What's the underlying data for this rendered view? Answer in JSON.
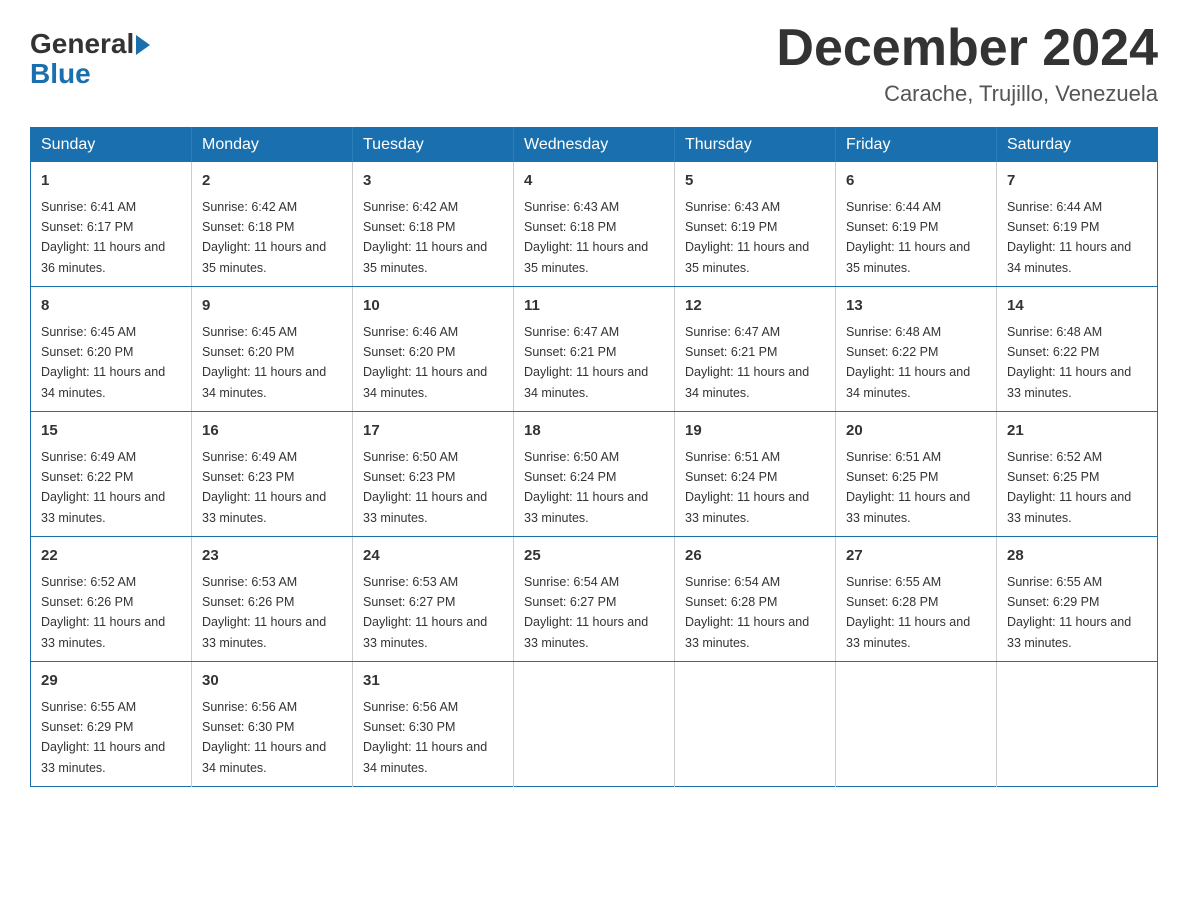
{
  "logo": {
    "general": "General",
    "blue": "Blue"
  },
  "title": {
    "month": "December 2024",
    "location": "Carache, Trujillo, Venezuela"
  },
  "headers": [
    "Sunday",
    "Monday",
    "Tuesday",
    "Wednesday",
    "Thursday",
    "Friday",
    "Saturday"
  ],
  "weeks": [
    [
      {
        "day": "1",
        "sunrise": "6:41 AM",
        "sunset": "6:17 PM",
        "daylight": "11 hours and 36 minutes."
      },
      {
        "day": "2",
        "sunrise": "6:42 AM",
        "sunset": "6:18 PM",
        "daylight": "11 hours and 35 minutes."
      },
      {
        "day": "3",
        "sunrise": "6:42 AM",
        "sunset": "6:18 PM",
        "daylight": "11 hours and 35 minutes."
      },
      {
        "day": "4",
        "sunrise": "6:43 AM",
        "sunset": "6:18 PM",
        "daylight": "11 hours and 35 minutes."
      },
      {
        "day": "5",
        "sunrise": "6:43 AM",
        "sunset": "6:19 PM",
        "daylight": "11 hours and 35 minutes."
      },
      {
        "day": "6",
        "sunrise": "6:44 AM",
        "sunset": "6:19 PM",
        "daylight": "11 hours and 35 minutes."
      },
      {
        "day": "7",
        "sunrise": "6:44 AM",
        "sunset": "6:19 PM",
        "daylight": "11 hours and 34 minutes."
      }
    ],
    [
      {
        "day": "8",
        "sunrise": "6:45 AM",
        "sunset": "6:20 PM",
        "daylight": "11 hours and 34 minutes."
      },
      {
        "day": "9",
        "sunrise": "6:45 AM",
        "sunset": "6:20 PM",
        "daylight": "11 hours and 34 minutes."
      },
      {
        "day": "10",
        "sunrise": "6:46 AM",
        "sunset": "6:20 PM",
        "daylight": "11 hours and 34 minutes."
      },
      {
        "day": "11",
        "sunrise": "6:47 AM",
        "sunset": "6:21 PM",
        "daylight": "11 hours and 34 minutes."
      },
      {
        "day": "12",
        "sunrise": "6:47 AM",
        "sunset": "6:21 PM",
        "daylight": "11 hours and 34 minutes."
      },
      {
        "day": "13",
        "sunrise": "6:48 AM",
        "sunset": "6:22 PM",
        "daylight": "11 hours and 34 minutes."
      },
      {
        "day": "14",
        "sunrise": "6:48 AM",
        "sunset": "6:22 PM",
        "daylight": "11 hours and 33 minutes."
      }
    ],
    [
      {
        "day": "15",
        "sunrise": "6:49 AM",
        "sunset": "6:22 PM",
        "daylight": "11 hours and 33 minutes."
      },
      {
        "day": "16",
        "sunrise": "6:49 AM",
        "sunset": "6:23 PM",
        "daylight": "11 hours and 33 minutes."
      },
      {
        "day": "17",
        "sunrise": "6:50 AM",
        "sunset": "6:23 PM",
        "daylight": "11 hours and 33 minutes."
      },
      {
        "day": "18",
        "sunrise": "6:50 AM",
        "sunset": "6:24 PM",
        "daylight": "11 hours and 33 minutes."
      },
      {
        "day": "19",
        "sunrise": "6:51 AM",
        "sunset": "6:24 PM",
        "daylight": "11 hours and 33 minutes."
      },
      {
        "day": "20",
        "sunrise": "6:51 AM",
        "sunset": "6:25 PM",
        "daylight": "11 hours and 33 minutes."
      },
      {
        "day": "21",
        "sunrise": "6:52 AM",
        "sunset": "6:25 PM",
        "daylight": "11 hours and 33 minutes."
      }
    ],
    [
      {
        "day": "22",
        "sunrise": "6:52 AM",
        "sunset": "6:26 PM",
        "daylight": "11 hours and 33 minutes."
      },
      {
        "day": "23",
        "sunrise": "6:53 AM",
        "sunset": "6:26 PM",
        "daylight": "11 hours and 33 minutes."
      },
      {
        "day": "24",
        "sunrise": "6:53 AM",
        "sunset": "6:27 PM",
        "daylight": "11 hours and 33 minutes."
      },
      {
        "day": "25",
        "sunrise": "6:54 AM",
        "sunset": "6:27 PM",
        "daylight": "11 hours and 33 minutes."
      },
      {
        "day": "26",
        "sunrise": "6:54 AM",
        "sunset": "6:28 PM",
        "daylight": "11 hours and 33 minutes."
      },
      {
        "day": "27",
        "sunrise": "6:55 AM",
        "sunset": "6:28 PM",
        "daylight": "11 hours and 33 minutes."
      },
      {
        "day": "28",
        "sunrise": "6:55 AM",
        "sunset": "6:29 PM",
        "daylight": "11 hours and 33 minutes."
      }
    ],
    [
      {
        "day": "29",
        "sunrise": "6:55 AM",
        "sunset": "6:29 PM",
        "daylight": "11 hours and 33 minutes."
      },
      {
        "day": "30",
        "sunrise": "6:56 AM",
        "sunset": "6:30 PM",
        "daylight": "11 hours and 34 minutes."
      },
      {
        "day": "31",
        "sunrise": "6:56 AM",
        "sunset": "6:30 PM",
        "daylight": "11 hours and 34 minutes."
      },
      null,
      null,
      null,
      null
    ]
  ]
}
